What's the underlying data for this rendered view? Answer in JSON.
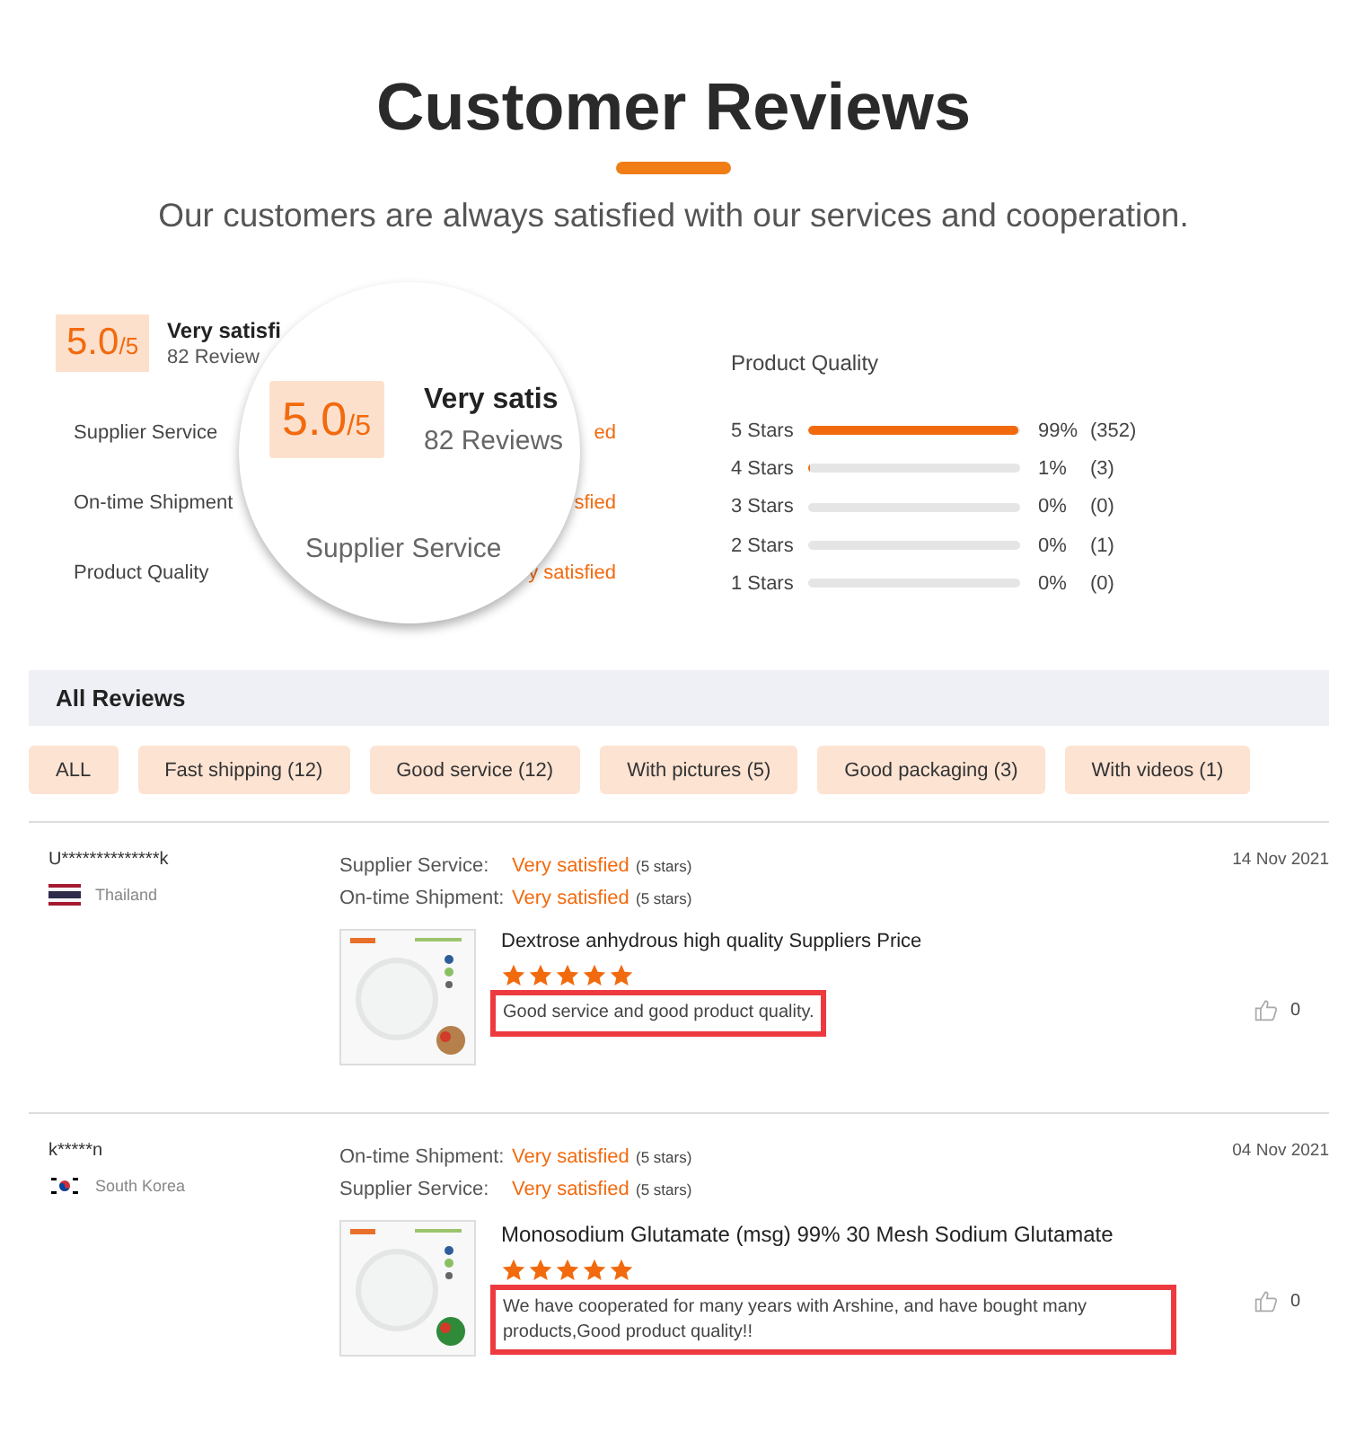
{
  "title": "Customer Reviews",
  "subtitle": "Our customers are always satisfied with our services and cooperation.",
  "summary": {
    "score": "5.0",
    "out_of": "/5",
    "headline": "Very satisfi",
    "reviews": "82 Review",
    "ratings": [
      {
        "label": "Supplier Service",
        "value": "ed"
      },
      {
        "label": "On-time Shipment",
        "value": "sfied"
      },
      {
        "label": "Product Quality",
        "value": "y satisfied"
      }
    ]
  },
  "magnifier": {
    "score": "5.0",
    "out_of": "/5",
    "headline": "Very satis",
    "reviews": "82 Reviews",
    "label": "Supplier Service"
  },
  "breakdown": {
    "title": "Product Quality",
    "rows": [
      {
        "label": "5 Stars",
        "level": 0.99,
        "percent": "99%",
        "count": "(352)"
      },
      {
        "label": "4 Stars",
        "level": 0.01,
        "percent": "1%",
        "count": "(3)"
      },
      {
        "label": "3 Stars",
        "percent": "0%",
        "count": "(0)"
      },
      {
        "label": "2 Stars",
        "percent": "0%",
        "count": "(1)"
      },
      {
        "label": "1 Stars",
        "percent": "0%",
        "count": "(0)"
      }
    ]
  },
  "all_reviews": {
    "title": "All Reviews"
  },
  "filters": [
    "ALL",
    "Fast shipping (12)",
    "Good service (12)",
    "With pictures (5)",
    "Good packaging (3)",
    "With videos (1)"
  ],
  "reviews": [
    {
      "user": "U**************k",
      "country": "Thailand",
      "flag": {
        "kind": "thailand"
      },
      "date": "14 Nov 2021",
      "ratings": [
        {
          "label": "Supplier Service:",
          "value": "Very satisfied",
          "stars_text": "(5 stars)"
        },
        {
          "label": "On-time Shipment:",
          "value": "Very satisfied",
          "stars_text": "(5 stars)"
        }
      ],
      "product": "Dextrose anhydrous high quality Suppliers Price",
      "stars": 5,
      "comment": "Good service and good product quality.",
      "likes": "0"
    },
    {
      "user": "k*****n",
      "country": "South Korea",
      "flag": {
        "kind": "korea"
      },
      "date": "04 Nov 2021",
      "ratings": [
        {
          "label": "On-time Shipment:",
          "value": "Very satisfied",
          "stars_text": "(5 stars)"
        },
        {
          "label": "Supplier Service:",
          "value": "Very satisfied",
          "stars_text": "(5 stars)"
        }
      ],
      "product": "Monosodium Glutamate (msg) 99% 30 Mesh Sodium Glutamate",
      "stars": 5,
      "comment": "We have cooperated for many years with Arshine, and have bought many products,Good product quality!!",
      "likes": "0"
    }
  ]
}
